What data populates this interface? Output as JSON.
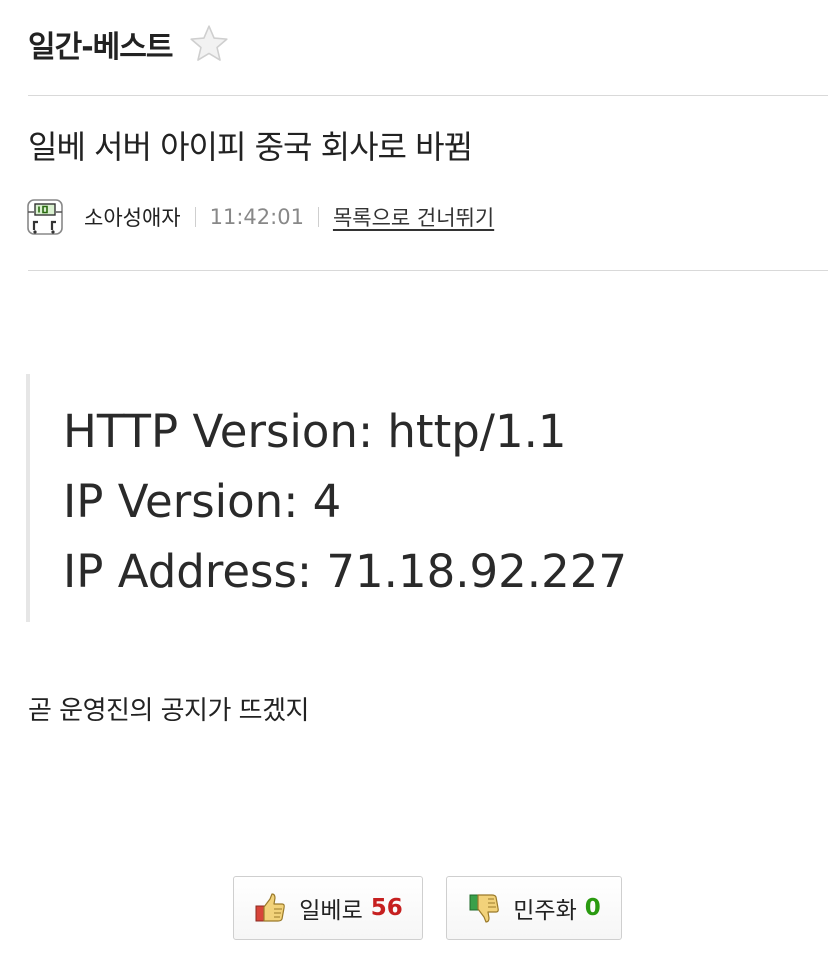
{
  "board": {
    "title": "일간-베스트"
  },
  "post": {
    "title": "일베 서버 아이피 중국 회사로 바뀜",
    "author": "소아성애자",
    "time": "11:42:01",
    "skip_link": "목록으로 건너뛰기",
    "quote_lines": [
      "HTTP Version: http/1.1",
      "IP Version: 4",
      "IP Address: 71.18.92.227"
    ],
    "body": "곧 운영진의 공지가 뜨겠지"
  },
  "votes": {
    "up_label": "일베로",
    "up_count": "56",
    "down_label": "민주화",
    "down_count": "0"
  },
  "colors": {
    "up_count": "#c62020",
    "down_count": "#2a9a10"
  },
  "icons": {
    "favorite": "star-icon",
    "avatar": "level-badge-icon",
    "upvote": "thumbs-up-icon",
    "downvote": "thumbs-down-icon"
  }
}
